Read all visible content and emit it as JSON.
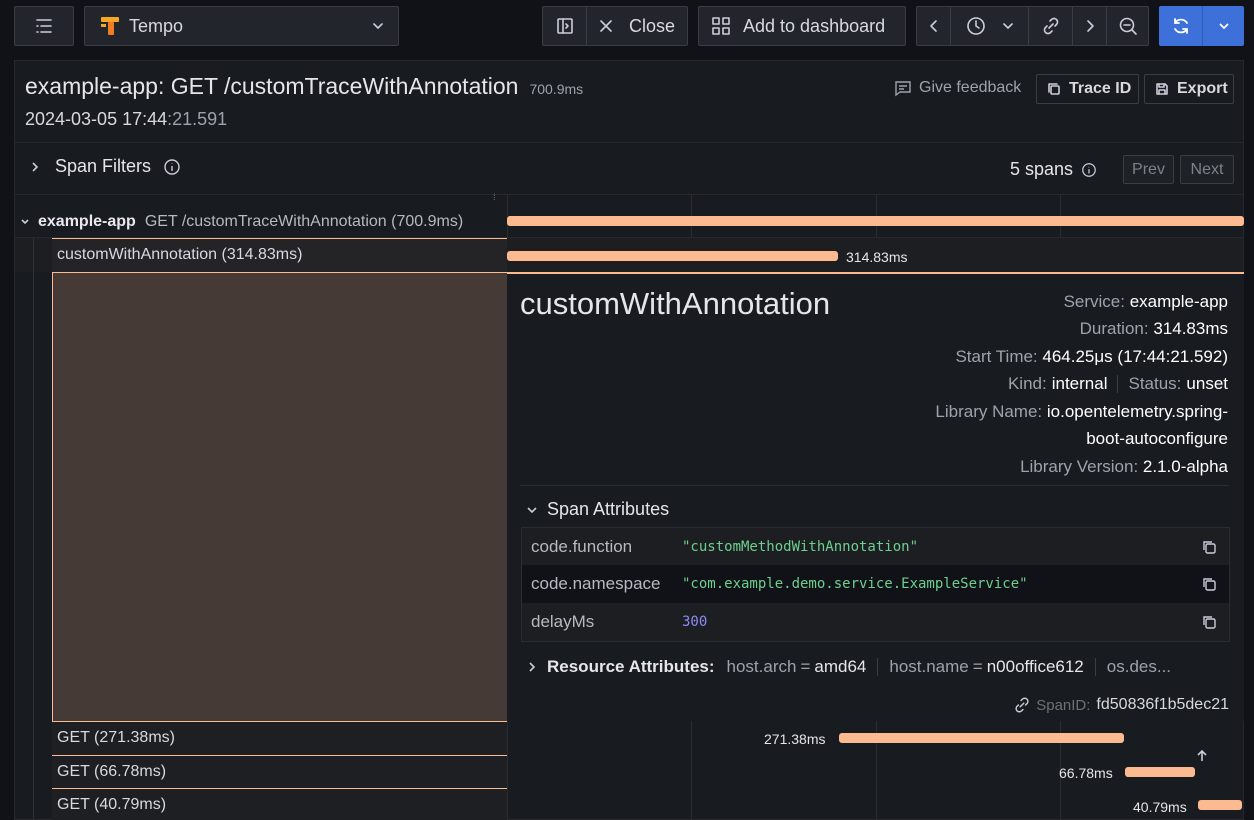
{
  "toolbar": {
    "datasource": "Tempo",
    "close_label": "Close",
    "add_dashboard_label": "Add to dashboard"
  },
  "trace": {
    "title": "example-app: GET /customTraceWithAnnotation",
    "duration": "700.9ms",
    "timestamp_main": "2024-03-05 17:44",
    "timestamp_sub": ":21.591",
    "give_feedback": "Give feedback",
    "trace_id_label": "Trace ID",
    "export_label": "Export"
  },
  "filters": {
    "label": "Span Filters",
    "span_count": "5 spans",
    "prev": "Prev",
    "next": "Next"
  },
  "spans": {
    "root_service": "example-app",
    "root_name": "GET /customTraceWithAnnotation (700.9ms)",
    "child_name": "customWithAnnotation (314.83ms)",
    "child_duration": "314.83ms",
    "rows": [
      {
        "name": "GET (271.38ms)",
        "duration": "271.38ms"
      },
      {
        "name": "GET (66.78ms)",
        "duration": "66.78ms"
      },
      {
        "name": "GET (40.79ms)",
        "duration": "40.79ms"
      }
    ]
  },
  "detail": {
    "name": "customWithAnnotation",
    "service_label": "Service:",
    "service_value": "example-app",
    "duration_label": "Duration:",
    "duration_value": "314.83ms",
    "start_label": "Start Time:",
    "start_value": "464.25μs (17:44:21.592)",
    "kind_label": "Kind:",
    "kind_value": "internal",
    "status_label": "Status:",
    "status_value": "unset",
    "library_label": "Library Name:",
    "library_value_1": "io.opentelemetry.spring-",
    "library_value_2": "boot-autoconfigure",
    "libver_label": "Library Version:",
    "libver_value": "2.1.0-alpha",
    "span_attributes_label": "Span Attributes",
    "attributes": [
      {
        "key": "code.function",
        "value": "\"customMethodWithAnnotation\""
      },
      {
        "key": "code.namespace",
        "value": "\"com.example.demo.service.ExampleService\""
      },
      {
        "key": "delayMs",
        "value": "300"
      }
    ],
    "resource_label": "Resource Attributes:",
    "res1_key": "host.arch",
    "res1_val": "amd64",
    "res2_key": "host.name",
    "res2_val": "n00office612",
    "res3_key": "os.des...",
    "spanid_label": "SpanID:",
    "spanid_value": "fd50836f1b5dec21"
  },
  "colors": {
    "bar": "#fbba8f",
    "primary": "#3d71d9",
    "string_value": "#6ccf8e",
    "number_value": "#8b8bf5"
  }
}
